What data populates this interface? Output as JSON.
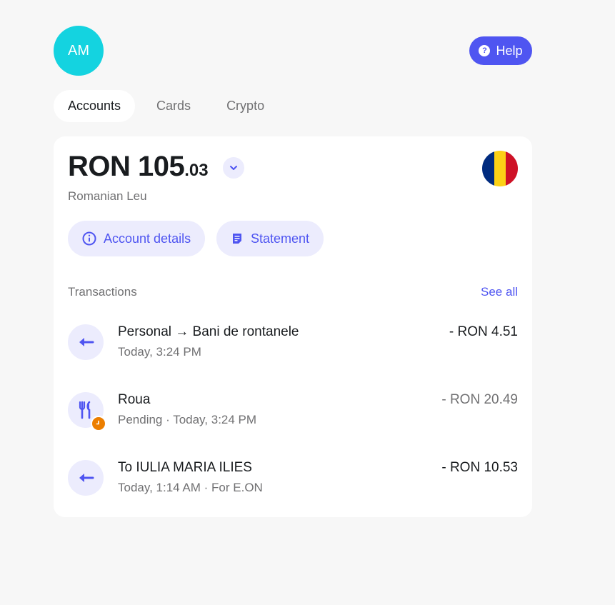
{
  "header": {
    "avatar_initials": "AM",
    "help_label": "Help"
  },
  "tabs": [
    {
      "label": "Accounts",
      "active": true
    },
    {
      "label": "Cards",
      "active": false
    },
    {
      "label": "Crypto",
      "active": false
    }
  ],
  "account": {
    "balance_main": "RON 105",
    "balance_decimal": ".03",
    "currency_name": "Romanian Leu",
    "flag_colors": [
      "#002b7f",
      "#fcd116",
      "#ce1126"
    ],
    "details_label": "Account details",
    "statement_label": "Statement"
  },
  "transactions": {
    "header_label": "Transactions",
    "see_all_label": "See all",
    "items": [
      {
        "title": "Personal → Bani de rontanele",
        "subtitle": "Today, 3:24 PM",
        "amount": "- RON 4.51",
        "icon": "arrow-left-icon",
        "pending": false
      },
      {
        "title": "Roua",
        "subtitle": "Pending · Today, 3:24 PM",
        "amount": "- RON 20.49",
        "icon": "fork-knife-icon",
        "pending": true
      },
      {
        "title": "To IULIA MARIA ILIES",
        "subtitle": "Today, 1:14 AM · For E.ON",
        "amount": "- RON 10.53",
        "icon": "arrow-left-icon",
        "pending": false
      }
    ]
  },
  "colors": {
    "accent": "#4f55f1",
    "avatar": "#14d3e0",
    "pending_badge": "#ec7e00",
    "background": "#f7f7f7"
  }
}
